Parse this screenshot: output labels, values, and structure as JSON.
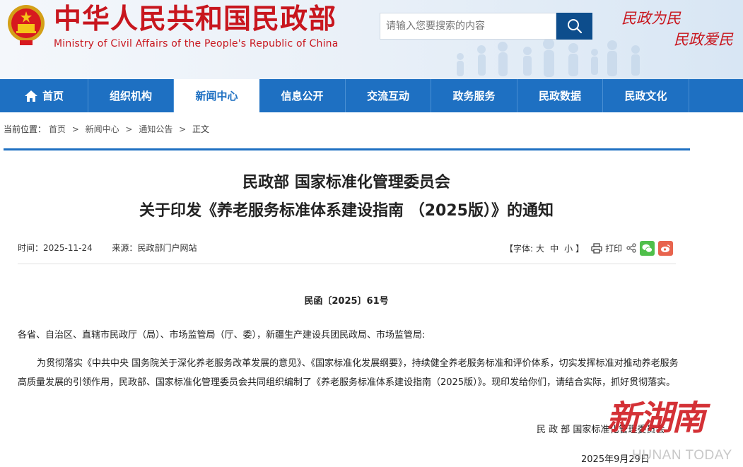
{
  "header": {
    "site_title": "中华人民共和国民政部",
    "site_subtitle": "Ministry of Civil Affairs of the People's Republic of China",
    "slogan_line1": "民政为民",
    "slogan_line2": "民政爱民",
    "emblem_icon": "national-emblem-icon"
  },
  "search": {
    "placeholder": "请输入您要搜索的内容",
    "value": "",
    "button_icon": "search-icon"
  },
  "nav": {
    "items": [
      {
        "label": "首页",
        "icon": "home-icon"
      },
      {
        "label": "组织机构"
      },
      {
        "label": "新闻中心",
        "active": true
      },
      {
        "label": "信息公开"
      },
      {
        "label": "交流互动"
      },
      {
        "label": "政务服务"
      },
      {
        "label": "民政数据"
      },
      {
        "label": "民政文化"
      }
    ]
  },
  "breadcrumb": {
    "prefix": "当前位置：",
    "items": [
      "首页",
      "新闻中心",
      "通知公告"
    ],
    "current": "正文",
    "separator": ">"
  },
  "article": {
    "title_line1": "民政部 国家标准化管理委员会",
    "title_line2": "关于印发《养老服务标准体系建设指南 （2025版）》的通知",
    "time_label": "时间：",
    "time_value": "2025-11-24",
    "source_label": "来源：",
    "source_value": "民政部门户网站",
    "font_size_prefix": "【字体:",
    "font_size_options": [
      "大",
      "中",
      "小"
    ],
    "font_size_suffix": "】",
    "print_label": "打印",
    "doc_number": "民函〔2025〕61号",
    "addressee": "各省、自治区、直辖市民政厅（局）、市场监管局（厅、委），新疆生产建设兵团民政局、市场监管局:",
    "body": "为贯彻落实《中共中央 国务院关于深化养老服务改革发展的意见》、《国家标准化发展纲要》，持续健全养老服务标准和评价体系，切实发挥标准对推动养老服务高质量发展的引领作用，民政部、国家标准化管理委员会共同组织编制了《养老服务标准体系建设指南（2025版）》。现印发给你们，请结合实际，抓好贯彻落实。",
    "signature": "民 政 部 国家标准化管理委员会",
    "date": "2025年9月29日"
  },
  "watermark": {
    "cn": "新湖南",
    "en": "HUNAN TODAY"
  },
  "colors": {
    "brand_red": "#c8161e",
    "nav_blue": "#1e70c2",
    "search_button": "#0d4d8c",
    "wechat_green": "#4fbf4a",
    "weibo_orange": "#e8644e"
  }
}
